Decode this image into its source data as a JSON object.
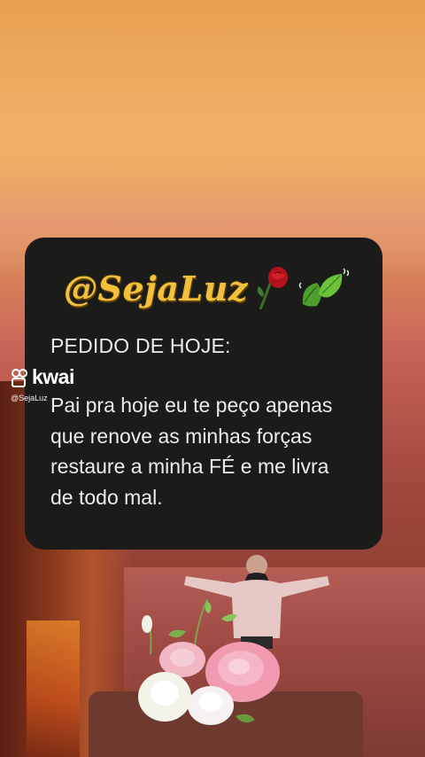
{
  "background": {
    "scene": "canyon-sunset",
    "colors": {
      "sky_top": "#e9a04f",
      "sky_mid": "#f0b36a",
      "rock": "#a54a3f"
    }
  },
  "post": {
    "logo_text": "@SejaLuz",
    "title": "PEDIDO DE HOJE:",
    "message": "Pai pra hoje eu te peço apenas que renove as minhas forças restaure a minha FÉ e me livra de todo mal.",
    "card_color": "#1b1b1a",
    "text_color": "#ececea",
    "logo_color": "#f2c13b"
  },
  "watermark": {
    "brand": "kwai",
    "handle": "@SejaLuz",
    "icon": "kwai-logo-icon"
  },
  "decorations": {
    "rose_icon": "red-rose-icon",
    "leaf_icon": "green-leaves-icon",
    "flowers_icon": "rose-bouquet-icon",
    "person": "person-arms-open"
  }
}
